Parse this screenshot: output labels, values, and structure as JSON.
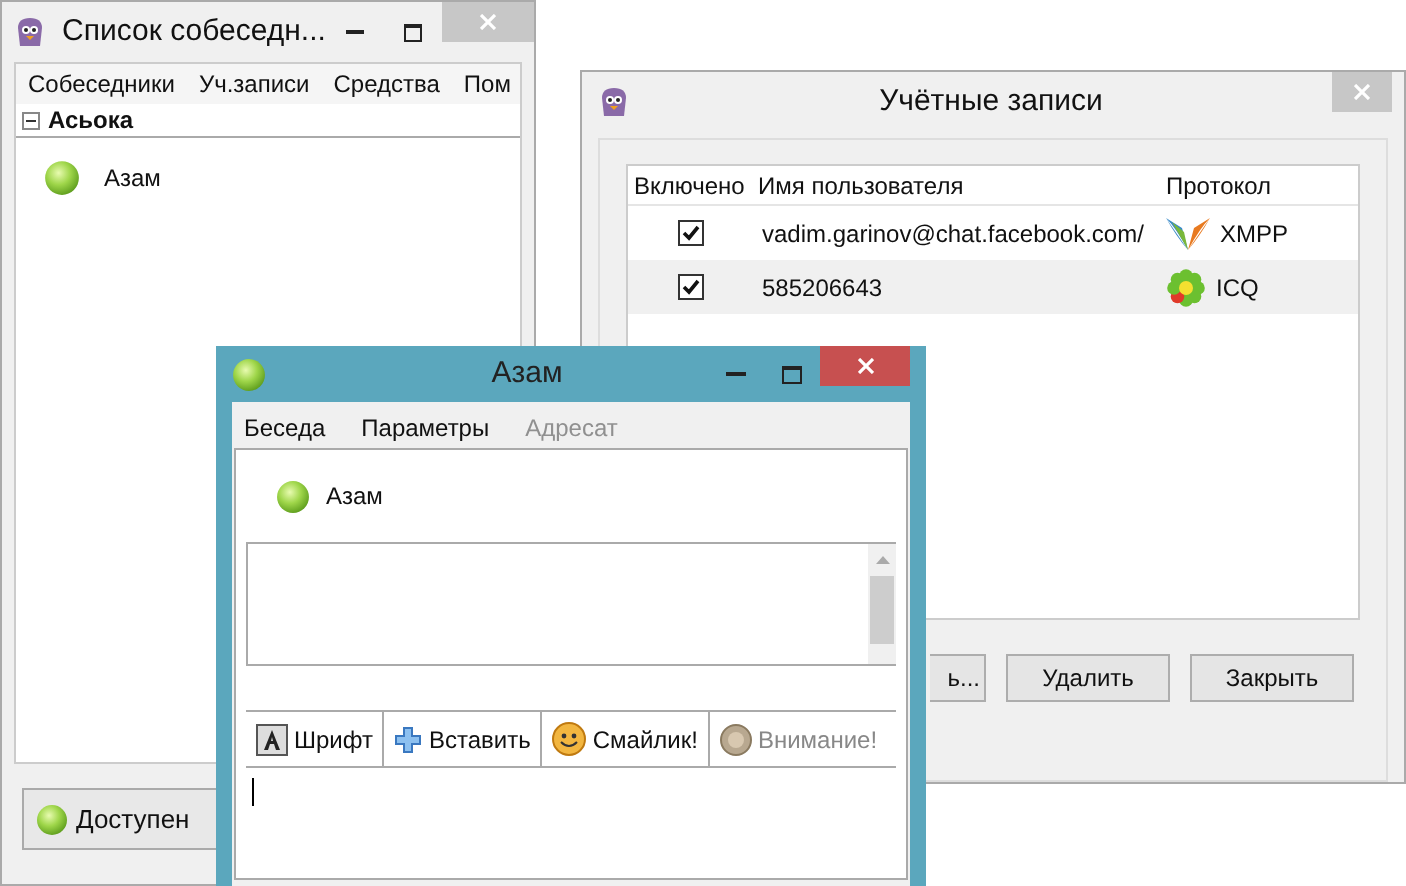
{
  "buddy_window": {
    "title": "Список собеседн...",
    "menu": [
      "Собеседники",
      "Уч.записи",
      "Средства",
      "Пом"
    ],
    "group": {
      "name": "Асьока",
      "expanded": true
    },
    "buddies": [
      {
        "name": "Азам"
      }
    ],
    "status": "Доступен"
  },
  "accounts_window": {
    "title": "Учётные записи",
    "columns": [
      "Включено",
      "Имя пользователя",
      "Протокол"
    ],
    "rows": [
      {
        "enabled": true,
        "username": "vadim.garinov@chat.facebook.com/",
        "protocol": "XMPP",
        "kind": "xmpp"
      },
      {
        "enabled": true,
        "username": "585206643",
        "protocol": "ICQ",
        "kind": "icq"
      }
    ],
    "buttons": [
      "ь...",
      "Удалить",
      "Закрыть"
    ]
  },
  "chat_window": {
    "title": "Азам",
    "menu": [
      {
        "label": "Беседа",
        "disabled": false
      },
      {
        "label": "Параметры",
        "disabled": false
      },
      {
        "label": "Адресат",
        "disabled": true
      }
    ],
    "contact": "Азам",
    "toolbar": [
      {
        "label": "Шрифт",
        "kind": "font",
        "disabled": false
      },
      {
        "label": "Вставить",
        "kind": "insert",
        "disabled": false
      },
      {
        "label": "Смайлик!",
        "kind": "smiley",
        "disabled": false
      },
      {
        "label": "Внимание!",
        "kind": "attention",
        "disabled": true
      }
    ]
  }
}
